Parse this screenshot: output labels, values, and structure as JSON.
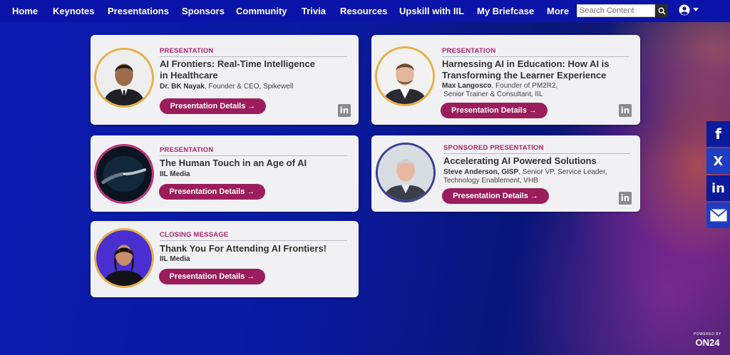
{
  "nav": {
    "items": [
      "Home",
      "Keynotes",
      "Presentations",
      "Sponsors",
      "Community",
      "Trivia",
      "Resources",
      "Upskill with IIL",
      "My Briefcase",
      "More"
    ],
    "search_placeholder": "Search Content"
  },
  "cards": [
    {
      "kind": "PRESENTATION",
      "title_line1": "AI Frontiers: Real-Time Intelligence",
      "title_line2": "in Healthcare",
      "speaker_name": "Dr. BK Nayak",
      "speaker_role": ", Founder & CEO, Spikewell",
      "speaker_role2": "",
      "button": "Presentation Details →",
      "linkedin": "in"
    },
    {
      "kind": "PRESENTATION",
      "title_line1": "Harnessing AI in Education: How AI is",
      "title_line2": "Transforming the Learner Experience",
      "speaker_name": "Max Langosco",
      "speaker_role": ", Founder of PM2R2,",
      "speaker_role2": "Senior Trainer & Consultant, IIL",
      "button": "Presentation Details →",
      "linkedin": "in"
    },
    {
      "kind": "PRESENTATION",
      "title_line1": "The Human Touch in an Age of AI",
      "title_line2": "",
      "speaker_name": "IIL Media",
      "speaker_role": "",
      "speaker_role2": "",
      "button": "Presentation Details →",
      "linkedin": ""
    },
    {
      "kind": "SPONSORED PRESENTATION",
      "title_line1": "Accelerating AI Powered Solutions",
      "title_line2": "",
      "speaker_name": "Steve Anderson, GISP",
      "speaker_role": ", Senior VP, Service Leader,",
      "speaker_role2": "Technology Enablement, VHB",
      "button": "Presentation Details →",
      "linkedin": "in"
    },
    {
      "kind": "CLOSING MESSAGE",
      "title_line1": "Thank You For Attending AI Frontiers!",
      "title_line2": "",
      "speaker_name": "IIL Media",
      "speaker_role": "",
      "speaker_role2": "",
      "button": "Presentation Details →",
      "linkedin": ""
    }
  ],
  "share": [
    "f",
    "X",
    "in",
    "mail"
  ],
  "footer": {
    "powered": "POWERED BY",
    "brand": "ON24"
  },
  "colors": {
    "accent": "#9b1d5b",
    "nav_bg": "#0a14a8",
    "kind_text": "#b0226a"
  }
}
